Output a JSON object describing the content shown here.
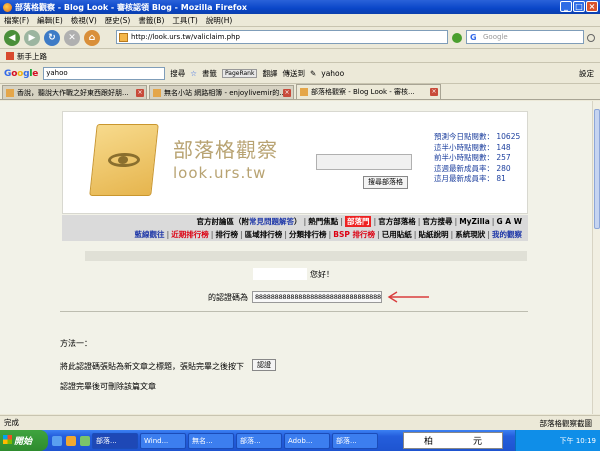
{
  "window": {
    "title": "部落格觀察 - Blog Look - 審核認領 Blog - Mozilla Firefox"
  },
  "menu": [
    "檔案(F)",
    "編輯(E)",
    "檢視(V)",
    "歷史(S)",
    "書籤(B)",
    "工具(T)",
    "說明(H)"
  ],
  "nav": {
    "url": "http://look.urs.tw/valiclaim.php",
    "search_placeholder": "Google"
  },
  "bookmarks": {
    "first": "新手上路"
  },
  "google_toolbar": {
    "logo": "Google",
    "query": "yahoo",
    "search_label": "搜尋",
    "bookmarks_label": "書籤",
    "pagerank_label": "PageRank",
    "translate_label": "翻譯",
    "send_label": "傳送到",
    "yahoo_label": "yahoo",
    "settings_label": "設定"
  },
  "tabs": [
    {
      "label": "香說，聽說大作戰之好東西跟好朋...",
      "active": false
    },
    {
      "label": "無名小站 網路相簿 - enjoylivemir的...",
      "active": false
    },
    {
      "label": "部落格觀察 - Blog Look - 審核...",
      "active": true
    }
  ],
  "site": {
    "title": "部落格觀察",
    "url": "look.urs.tw",
    "search_button": "搜尋部落格",
    "stats": [
      {
        "label": "預測今日點閱數",
        "value": "10625"
      },
      {
        "label": "這半小時點閱數",
        "value": "148"
      },
      {
        "label": "前半小時點閱數",
        "value": "257"
      },
      {
        "label": "這週最新成員率",
        "value": "280"
      },
      {
        "label": "這月最新成員率",
        "value": "81"
      }
    ],
    "nav_row1": {
      "forum_prefix": "官方討論區（附",
      "faq": "常見問題解答",
      "forum_suffix": "）",
      "hot_topics": "熱門焦點",
      "hot_blogs": "部落門",
      "official_blog": "官方部落格",
      "official_search": "官方搜尋",
      "myzilla": "MyZilla",
      "gaw": "G A W"
    },
    "nav_row2": {
      "blue_link": "藍線觀往",
      "recent": "近期排行榜",
      "ranking": "排行榜",
      "region": "區域排行榜",
      "category": "分類排行榜",
      "bsp": "BSP 排行榜",
      "used_tags": "已用貼紙",
      "tag_help": "貼紙說明",
      "status": "系統現狀",
      "my_look": "我的觀察"
    }
  },
  "claim": {
    "greeting": "您好！",
    "code_label": "的認證碼為",
    "code_value": "8888888888888888888888888888888888",
    "method": "方法一：",
    "instruction": "將此認證碼張貼為新文章之標題，張貼完畢之後按下",
    "confirm_button": "認證",
    "after": "認證完畢後可刪除該篇文章"
  },
  "status": {
    "left": "完成",
    "right": "部落格觀察截圖"
  },
  "taskbar": {
    "start": "開始",
    "tasks": [
      "部落...",
      "Wind...",
      "無名...",
      "部落...",
      "Adob...",
      "部落..."
    ],
    "ime": [
      "柏",
      "元"
    ],
    "clock": "下午 10:19"
  },
  "colors": {
    "titlebar": "#0A46C8",
    "site_brand": "#B8A372",
    "stats_text": "#1C3F9E",
    "highlight_red": "#EE2222",
    "arrow": "#D93C3C"
  }
}
